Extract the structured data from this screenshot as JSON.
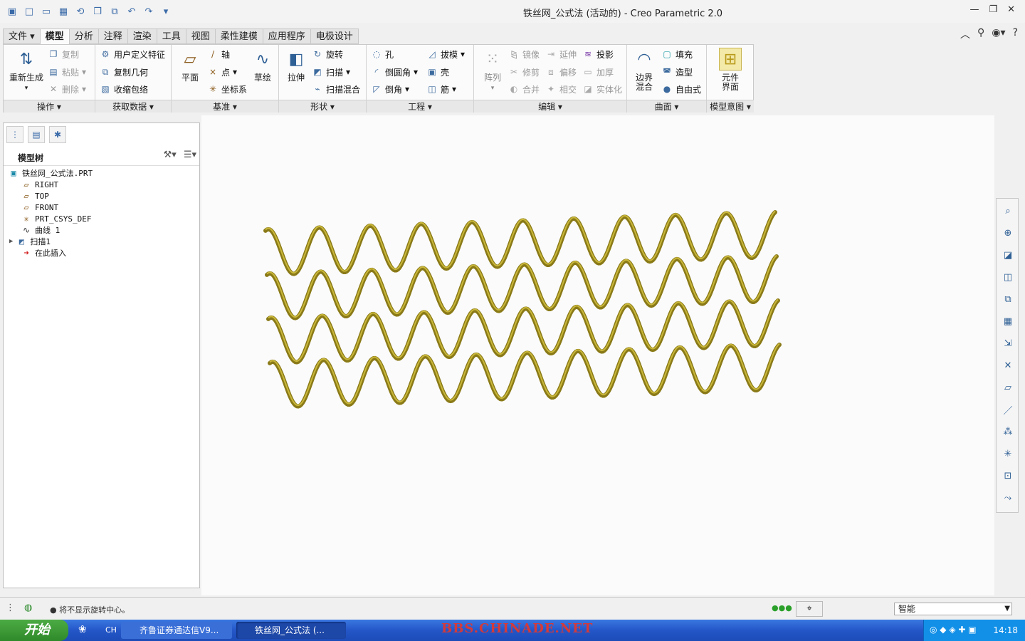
{
  "window": {
    "title": "铁丝网_公式法 (活动的) - Creo Parametric 2.0"
  },
  "qat": {
    "icons": [
      "app-icon",
      "new-icon",
      "open-icon",
      "save-icon",
      "regen-icon",
      "copy-icon",
      "window-icon",
      "undo-icon",
      "redo-icon"
    ]
  },
  "tabs": [
    {
      "label": "文件 ▾",
      "active": false
    },
    {
      "label": "模型",
      "active": true
    },
    {
      "label": "分析",
      "active": false
    },
    {
      "label": "注释",
      "active": false
    },
    {
      "label": "渲染",
      "active": false
    },
    {
      "label": "工具",
      "active": false
    },
    {
      "label": "视图",
      "active": false
    },
    {
      "label": "柔性建模",
      "active": false
    },
    {
      "label": "应用程序",
      "active": false
    },
    {
      "label": "电极设计",
      "active": false
    }
  ],
  "ribbon": {
    "operations": {
      "label": "操作 ▾",
      "regen": "重新生成",
      "copy": "复制",
      "paste": "粘贴",
      "delete": "删除"
    },
    "getdata": {
      "label": "获取数据 ▾",
      "udf": "用户定义特征",
      "copygeom": "复制几何",
      "shrinkwrap": "收缩包络"
    },
    "datum": {
      "label": "基准 ▾",
      "plane": "平面",
      "axis": "轴",
      "point": "点",
      "csys": "坐标系",
      "sketch": "草绘"
    },
    "shapes": {
      "label": "形状 ▾",
      "extrude": "拉伸",
      "revolve": "旋转",
      "sweep": "扫描",
      "sweptblend": "扫描混合"
    },
    "engineering": {
      "label": "工程 ▾",
      "hole": "孔",
      "round": "倒圆角",
      "chamfer": "倒角",
      "draft": "拔模",
      "shell": "壳",
      "rib": "筋"
    },
    "editing": {
      "label": "编辑 ▾",
      "pattern": "阵列",
      "mirror": "镜像",
      "trim": "修剪",
      "merge": "合并",
      "extend": "延伸",
      "offset": "偏移",
      "intersect": "相交",
      "project": "投影",
      "thicken": "加厚",
      "solidify": "实体化"
    },
    "surfaces": {
      "label": "曲面 ▾",
      "boundary": "边界\n混合",
      "fill": "填充",
      "style": "造型",
      "freestyle": "自由式"
    },
    "intent": {
      "label": "模型意图 ▾",
      "component": "元件\n界面"
    }
  },
  "tree": {
    "title": "模型树",
    "items": [
      {
        "label": "铁丝网_公式法.PRT",
        "icon": "part-icon"
      },
      {
        "label": "RIGHT",
        "icon": "plane-icon"
      },
      {
        "label": "TOP",
        "icon": "plane-icon"
      },
      {
        "label": "FRONT",
        "icon": "plane-icon"
      },
      {
        "label": "PRT_CSYS_DEF",
        "icon": "csys-icon"
      },
      {
        "label": "曲线 1",
        "icon": "curve-icon"
      },
      {
        "label": "扫描1",
        "icon": "sweep-icon"
      },
      {
        "label": "在此插入",
        "icon": "insert-arrow-icon"
      }
    ]
  },
  "status": {
    "message": "● 将不显示旋转中心。",
    "filter": "智能"
  },
  "taskbar": {
    "start": "开始",
    "lang": "CH",
    "apps": [
      "齐鲁证券通达信V9...",
      "铁丝网_公式法 (..."
    ],
    "watermark": "BBS.CHINADE.NET",
    "clock": "14:18"
  },
  "colors": {
    "wire": "#8a7a18",
    "wire_highlight": "#c9b73a",
    "accent": "#3a6aa8"
  }
}
